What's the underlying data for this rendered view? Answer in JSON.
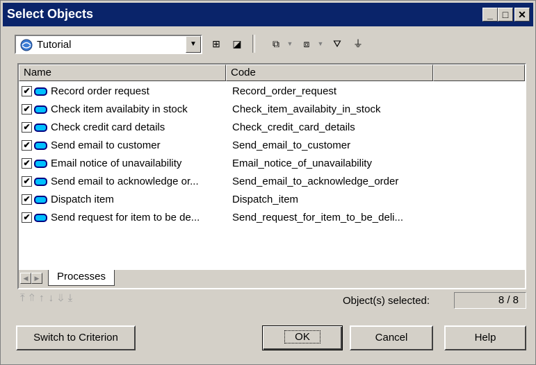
{
  "window": {
    "title": "Select Objects"
  },
  "toolbar": {
    "model_select_value": "Tutorial",
    "icons": [
      "hierarchy-icon",
      "include-subpackages-icon",
      "select-all-icon",
      "deselect-all-icon",
      "filter-icon",
      "filter-settings-icon"
    ]
  },
  "list": {
    "columns": [
      "Name",
      "Code",
      ""
    ],
    "rows": [
      {
        "checked": true,
        "name": "Record order request",
        "code": "Record_order_request"
      },
      {
        "checked": true,
        "name": "Check item availabity in stock",
        "code": "Check_item_availabity_in_stock"
      },
      {
        "checked": true,
        "name": "Check credit card details",
        "code": "Check_credit_card_details"
      },
      {
        "checked": true,
        "name": "Send email to customer",
        "code": "Send_email_to_customer"
      },
      {
        "checked": true,
        "name": "Email notice of unavailability",
        "code": "Email_notice_of_unavailability"
      },
      {
        "checked": true,
        "name": "Send email to acknowledge or...",
        "code": "Send_email_to_acknowledge_order"
      },
      {
        "checked": true,
        "name": "Dispatch item",
        "code": "Dispatch_item"
      },
      {
        "checked": true,
        "name": "Send request for item to be de...",
        "code": "Send_request_for_item_to_be_deli..."
      }
    ],
    "tab": "Processes"
  },
  "status": {
    "selected_label": "Object(s) selected:",
    "selected_value": "8 / 8"
  },
  "buttons": {
    "switch": "Switch to Criterion",
    "ok": "OK",
    "cancel": "Cancel",
    "help": "Help"
  },
  "colors": {
    "title_bar": "#0a246a",
    "dialog_bg": "#d4d0c8",
    "process_icon_fill": "#00c0ff"
  }
}
